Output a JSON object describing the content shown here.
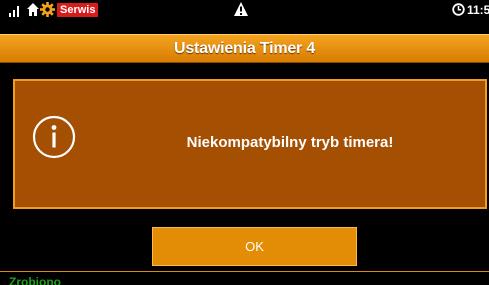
{
  "statusbar": {
    "signal_icon": "signal-icon",
    "home_icon": "home-icon",
    "gear_icon": "gear-icon",
    "mode_badge": "Serwis",
    "warning_icon": "warning-icon",
    "clock_icon": "clock-icon",
    "time": "11:5"
  },
  "header": {
    "title": "Ustawienia Timer 4"
  },
  "dialog": {
    "icon": "info-icon",
    "message": "Niekompatybilny tryb timera!",
    "ok_label": "OK"
  },
  "footer": {
    "status": "Zrobiono"
  },
  "colors": {
    "accent": "#E38C05",
    "dialog_bg": "#A54F02",
    "badge_red": "#D81C1C",
    "status_green": "#1FA01F"
  }
}
